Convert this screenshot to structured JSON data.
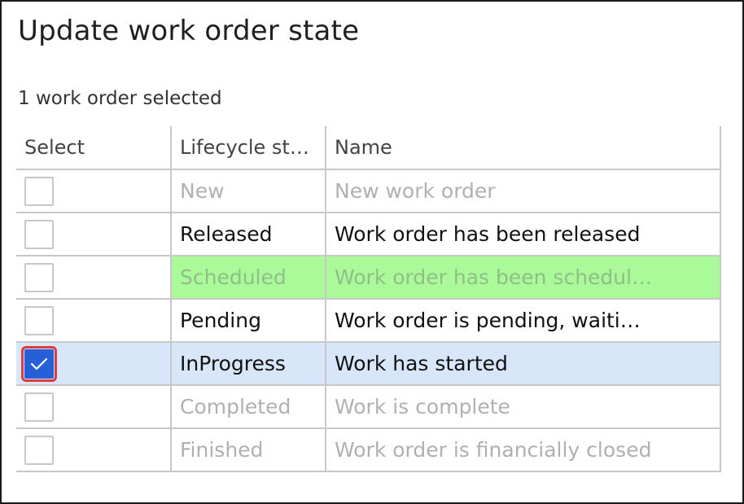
{
  "dialog": {
    "title": "Update work order state",
    "selection_summary": "1 work order selected"
  },
  "grid": {
    "columns": [
      "Select",
      "Lifecycle state",
      "Name"
    ],
    "rows": [
      {
        "state": "New",
        "name": "New work order",
        "checked": false,
        "enabled": false
      },
      {
        "state": "Released",
        "name": "Work order has been released",
        "checked": false,
        "enabled": true
      },
      {
        "state": "Scheduled",
        "name": "Work order has been schedul…",
        "checked": false,
        "enabled": false,
        "highlighted": true
      },
      {
        "state": "Pending",
        "name": "Work order is pending,  waiti…",
        "checked": false,
        "enabled": true
      },
      {
        "state": "InProgress",
        "name": "Work has started",
        "checked": true,
        "enabled": true,
        "selected": true
      },
      {
        "state": "Completed",
        "name": "Work is complete",
        "checked": false,
        "enabled": false
      },
      {
        "state": "Finished",
        "name": "Work order is financially closed",
        "checked": false,
        "enabled": false
      }
    ]
  },
  "colors": {
    "selected_row": "#d8e6fa",
    "highlight_row": "#aafa9a",
    "checkbox_checked": "#2660d8",
    "focus_outline": "#e0393e"
  },
  "icons": {
    "check": "check-icon"
  }
}
